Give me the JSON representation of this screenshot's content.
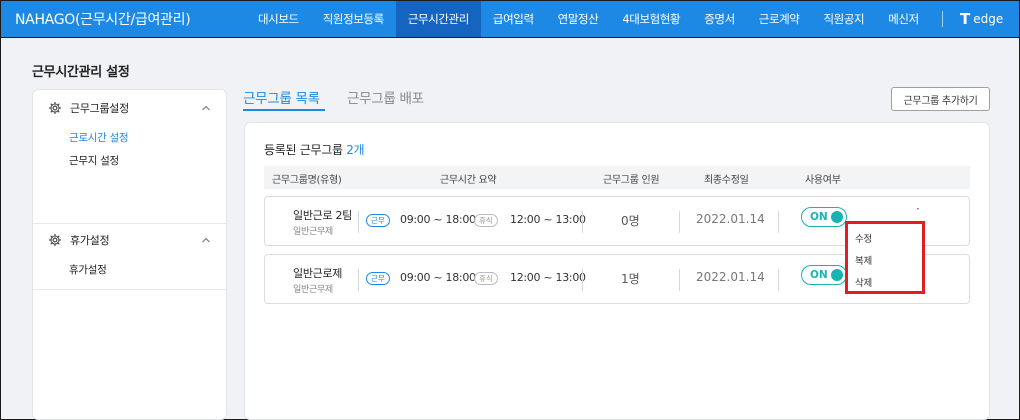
{
  "brand": "NAHAGO(근무시간/급여관리)",
  "nav": [
    "대시보드",
    "직원정보등록",
    "근무시간관리",
    "급여입력",
    "연말정산",
    "4대보험현황",
    "증명서",
    "근로계약",
    "직원공지",
    "메신저"
  ],
  "logo": {
    "mark": "T",
    "text": "edge"
  },
  "page_title": "근무시간관리 설정",
  "sidebar": {
    "groups": [
      {
        "label": "근무그룹설정",
        "icon": "gear-icon",
        "expanded": true,
        "items": [
          "근로시간 설정",
          "근무지 설정"
        ],
        "active_item": "근로시간 설정"
      },
      {
        "label": "휴가설정",
        "icon": "gear-icon",
        "expanded": true,
        "items": [
          "휴가설정"
        ]
      }
    ]
  },
  "tabs": [
    "근무그룹 목록",
    "근무그룹 배포"
  ],
  "active_tab": "근무그룹 목록",
  "add_button": "근무그룹 추가하기",
  "registered": {
    "label": "등록된 근무그룹",
    "count": "2개"
  },
  "table": {
    "columns": [
      "근무그룹명(유형)",
      "근무시간 요약",
      "근무그룹 인원",
      "최종수정일",
      "사용여부"
    ],
    "rows": [
      {
        "name": "일반근로 2팀",
        "type": "일반근무제",
        "work_tag": "근무",
        "work_time": "09:00 ~ 18:00",
        "rest_tag": "휴식",
        "rest_time": "12:00 ~ 13:00",
        "members": "0명",
        "updated": "2022.01.14",
        "status": "ON"
      },
      {
        "name": "일반근로제",
        "type": "일반근무제",
        "work_tag": "근무",
        "work_time": "09:00 ~ 18:00",
        "rest_tag": "휴식",
        "rest_time": "12:00 ~ 13:00",
        "members": "1명",
        "updated": "2022.01.14",
        "status": "ON"
      }
    ]
  },
  "context_menu": [
    "수정",
    "복제",
    "삭제"
  ],
  "colors": {
    "primary": "#1e88e5",
    "toggle": "#19b3b3",
    "highlight": "#e02020"
  }
}
